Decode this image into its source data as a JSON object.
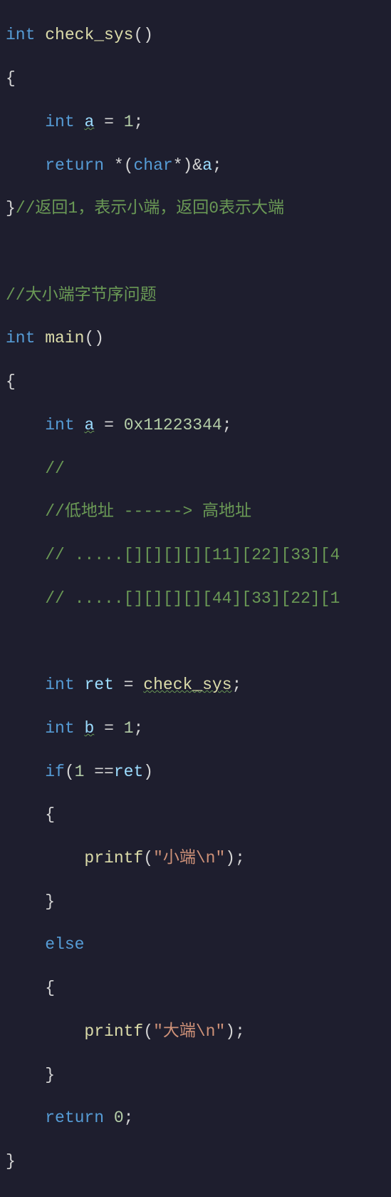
{
  "code": {
    "l1_int": "int",
    "l1_fn": "check_sys",
    "l1_paren": "()",
    "l2_brace": "{",
    "l3_int": "int",
    "l3_a": "a",
    "l3_eq": " = ",
    "l3_val": "1",
    "l3_semi": ";",
    "l4_ret": "return",
    "l4_star": " *(",
    "l4_char": "char",
    "l4_cast": "*)&",
    "l4_a": "a",
    "l4_semi": ";",
    "l5_brace": "}",
    "l5_cmt": "//返回1，表示小端，返回0表示大端",
    "l7_cmt": "//大小端字节序问题",
    "l8_int": "int",
    "l8_fn": "main",
    "l8_paren": "()",
    "l9_brace": "{",
    "l10_int": "int",
    "l10_a": "a",
    "l10_eq": " = ",
    "l10_val": "0x11223344",
    "l10_semi": ";",
    "l11_cmt": "//",
    "l12_cmt": "//低地址 ------> 高地址",
    "l13_cmt": "// .....[][][][][11][22][33][4",
    "l14_cmt": "// .....[][][][][44][33][22][1",
    "l16_int": "int",
    "l16_ret": "ret",
    "l16_eq": " = ",
    "l16_fn": "check_sys",
    "l16_semi": ";",
    "l17_int": "int",
    "l17_b": "b",
    "l17_eq": " = ",
    "l17_val": "1",
    "l17_semi": ";",
    "l18_if": "if",
    "l18_open": "(",
    "l18_val": "1",
    "l18_eq": " ==",
    "l18_ret": "ret",
    "l18_close": ")",
    "l19_brace": "{",
    "l20_printf": "printf",
    "l20_open": "(",
    "l20_str": "\"小端\\n\"",
    "l20_close": ");",
    "l21_brace": "}",
    "l22_else": "else",
    "l23_brace": "{",
    "l24_printf": "printf",
    "l24_open": "(",
    "l24_str": "\"大端\\n\"",
    "l24_close": ");",
    "l25_brace": "}",
    "l26_ret": "return",
    "l26_val": " 0",
    "l26_semi": ";",
    "l27_brace": "}"
  }
}
